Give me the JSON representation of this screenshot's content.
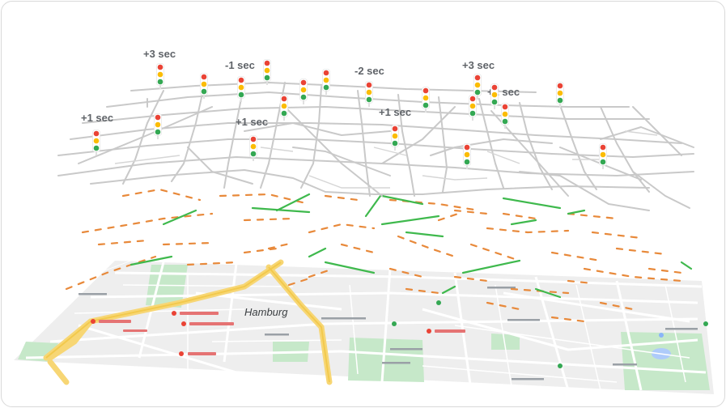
{
  "map": {
    "city_label": "Hamburg",
    "poi_labels": []
  },
  "timing_labels": [
    "+3 sec",
    "-1 sec",
    "-2 sec",
    "+3 sec",
    "+2 sec",
    "+1 sec",
    "+1 sec",
    "+1 sec"
  ],
  "colors": {
    "road_gray": "#c9c9c9",
    "traffic_orange": "#e8893a",
    "traffic_green": "#3fb94d",
    "map_bg": "#eeeeee",
    "map_highway": "#f7d674",
    "map_park": "#c6e8c9",
    "light_red": "#ea4335",
    "light_yellow": "#fbbc04",
    "light_green": "#34a853"
  },
  "traffic_light_count": 24
}
